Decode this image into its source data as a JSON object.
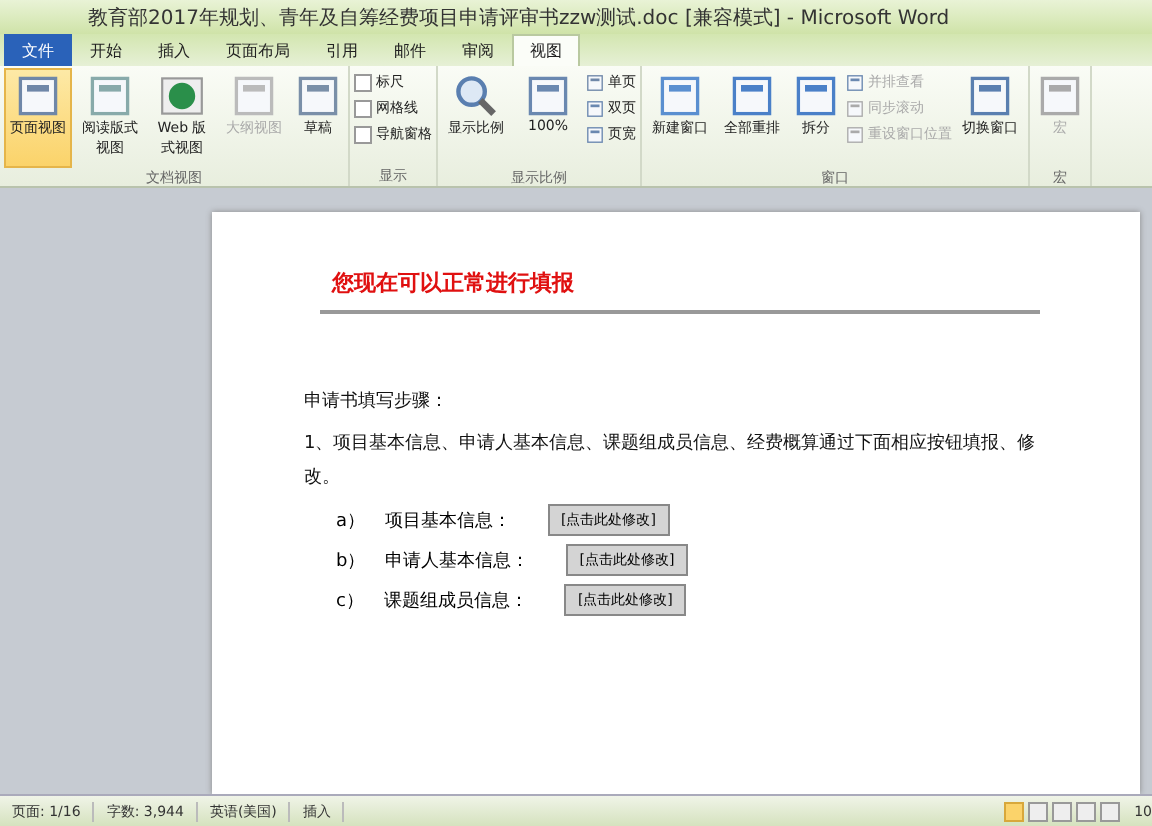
{
  "window": {
    "title": "教育部2017年规划、青年及自筹经费项目申请评审书zzw测试.doc [兼容模式] - Microsoft Word"
  },
  "tabs": [
    {
      "label": "文件",
      "kind": "file",
      "selected": false
    },
    {
      "label": "开始",
      "kind": "tab",
      "selected": false
    },
    {
      "label": "插入",
      "kind": "tab",
      "selected": false
    },
    {
      "label": "页面布局",
      "kind": "tab",
      "selected": false
    },
    {
      "label": "引用",
      "kind": "tab",
      "selected": false
    },
    {
      "label": "邮件",
      "kind": "tab",
      "selected": false
    },
    {
      "label": "审阅",
      "kind": "tab",
      "selected": false
    },
    {
      "label": "视图",
      "kind": "tab",
      "selected": true
    }
  ],
  "ribbon_groups": [
    {
      "label": "文档视图",
      "items": [
        {
          "kind": "large",
          "label": "页面视图",
          "selected": true,
          "disabled": false
        },
        {
          "kind": "large",
          "label": "阅读版式视图",
          "selected": false,
          "disabled": false
        },
        {
          "kind": "large",
          "label": "Web 版式视图",
          "selected": false,
          "disabled": false
        },
        {
          "kind": "large",
          "label": "大纲视图",
          "selected": false,
          "disabled": true
        },
        {
          "kind": "large",
          "label": "草稿",
          "selected": false,
          "disabled": false
        }
      ]
    },
    {
      "label": "显示",
      "items": [
        {
          "kind": "check",
          "label": "标尺",
          "checked": false
        },
        {
          "kind": "check",
          "label": "网格线",
          "checked": false
        },
        {
          "kind": "check",
          "label": "导航窗格",
          "checked": false
        }
      ]
    },
    {
      "label": "显示比例",
      "items": [
        {
          "kind": "large",
          "label": "显示比例",
          "selected": false,
          "disabled": false
        },
        {
          "kind": "large",
          "label": "100%",
          "selected": false,
          "disabled": false
        },
        {
          "kind": "small",
          "label": "单页",
          "disabled": false
        },
        {
          "kind": "small",
          "label": "双页",
          "disabled": false
        },
        {
          "kind": "small",
          "label": "页宽",
          "disabled": false
        }
      ]
    },
    {
      "label": "窗口",
      "items": [
        {
          "kind": "large",
          "label": "新建窗口",
          "selected": false,
          "disabled": false
        },
        {
          "kind": "large",
          "label": "全部重排",
          "selected": false,
          "disabled": false
        },
        {
          "kind": "large",
          "label": "拆分",
          "selected": false,
          "disabled": false
        },
        {
          "kind": "small",
          "label": "并排查看",
          "disabled": true
        },
        {
          "kind": "small",
          "label": "同步滚动",
          "disabled": true
        },
        {
          "kind": "small",
          "label": "重设窗口位置",
          "disabled": true
        },
        {
          "kind": "large",
          "label": "切换窗口",
          "selected": false,
          "disabled": false
        }
      ]
    },
    {
      "label": "宏",
      "items": [
        {
          "kind": "large",
          "label": "宏",
          "selected": false,
          "disabled": true
        }
      ]
    }
  ],
  "document": {
    "heading": "您现在可以正常进行填报",
    "steps_title": "申请书填写步骤：",
    "step_1": "1、项目基本信息、申请人基本信息、课题组成员信息、经费概算通过下面相应按钮填报、修改。",
    "sub_items": [
      {
        "marker": "a）",
        "label": "项目基本信息：",
        "button": "[点击此处修改]"
      },
      {
        "marker": "b）",
        "label": "申请人基本信息：",
        "button": "[点击此处修改]"
      },
      {
        "marker": "c）",
        "label": "课题组成员信息：",
        "button": "[点击此处修改]"
      }
    ]
  },
  "status_bar": {
    "page": "页面: 1/16",
    "words": "字数: 3,944",
    "language": "英语(美国)",
    "mode": "插入",
    "views": [
      {
        "selected": true
      },
      {
        "selected": false
      },
      {
        "selected": false
      },
      {
        "selected": false
      },
      {
        "selected": false
      }
    ],
    "zoom": "10"
  }
}
